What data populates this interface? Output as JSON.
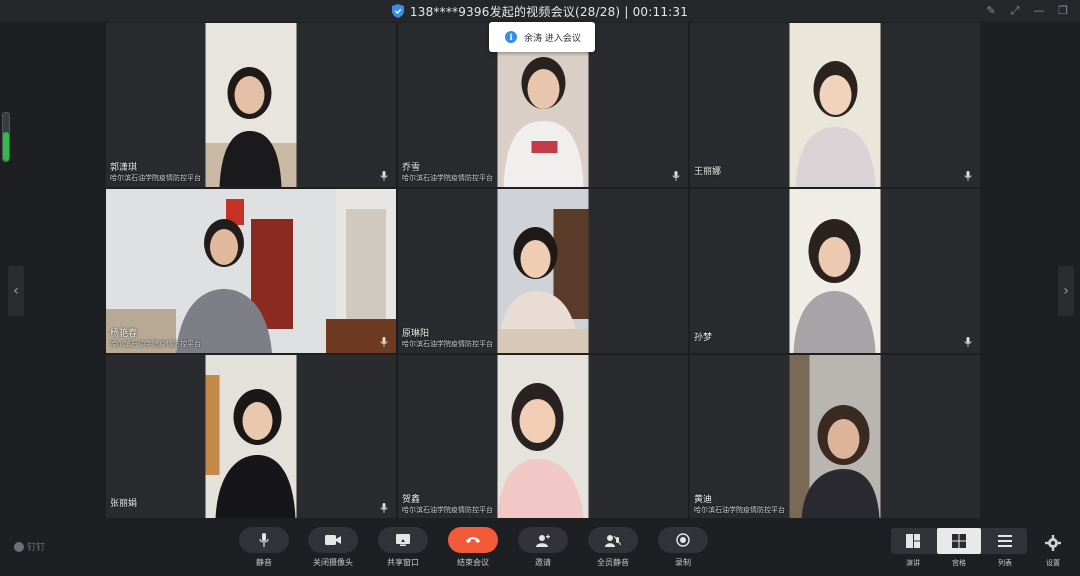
{
  "window": {
    "title": "138****9396发起的视频会议(28/28) | 00:11:31"
  },
  "toast": {
    "message": "余涛 进入会议"
  },
  "participants": [
    {
      "name": "郭潇琪",
      "org": "哈尔滨石油学院疫情防控平台"
    },
    {
      "name": "乔雪",
      "org": "哈尔滨石油学院疫情防控平台"
    },
    {
      "name": "王丽娜",
      "org": ""
    },
    {
      "name": "杨艳春",
      "org": "哈尔滨石油学院疫情防控平台"
    },
    {
      "name": "原琳阳",
      "org": "哈尔滨石油学院疫情防控平台"
    },
    {
      "name": "孙梦",
      "org": ""
    },
    {
      "name": "张丽娟",
      "org": ""
    },
    {
      "name": "贺鑫",
      "org": "哈尔滨石油学院疫情防控平台"
    },
    {
      "name": "黄迪",
      "org": "哈尔滨石油学院疫情防控平台"
    }
  ],
  "toolbar": {
    "brand": "钉钉",
    "mute": "静音",
    "camera_off": "关闭摄像头",
    "share_window": "共享窗口",
    "end_meeting": "结束会议",
    "invite": "邀请",
    "mute_all": "全员静音",
    "record": "录制",
    "layout_speaker": "演讲",
    "layout_grid": "宫格",
    "layout_list": "列表",
    "settings": "设置"
  },
  "icons": {
    "shield": "shield-icon",
    "mic": "microphone-icon",
    "camera": "camera-icon",
    "share": "share-window-icon",
    "hangup": "phone-hangup-icon",
    "invite": "add-person-icon",
    "mute_all": "mute-all-icon",
    "record": "record-icon",
    "settings": "gear-icon"
  },
  "colors": {
    "end_call": "#f25a3a",
    "accent": "#3a8ee6",
    "volume": "#2dbb4e"
  }
}
